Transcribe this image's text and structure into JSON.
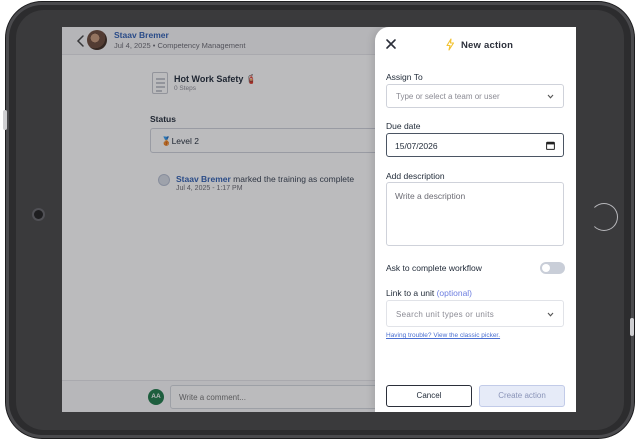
{
  "header": {
    "user_name": "Staav Bremer",
    "subtitle": "Jul 4, 2025 • Competency Management"
  },
  "training": {
    "title": "Hot Work Safety 🧯",
    "steps": "0 Steps"
  },
  "status": {
    "label": "Status",
    "value": "🥉Level 2"
  },
  "activity": {
    "actor": "Staav Bremer",
    "action": " marked the training as complete",
    "time": "Jul 4, 2025 - 1:17 PM"
  },
  "comment": {
    "avatar_initials": "AA",
    "placeholder": "Write a comment..."
  },
  "drawer": {
    "title": "New action",
    "assign_to": {
      "label": "Assign To",
      "placeholder": "Type or select a team or user"
    },
    "due_date": {
      "label": "Due date",
      "value": "15/07/2026"
    },
    "description": {
      "label": "Add description",
      "placeholder": "Write a description"
    },
    "workflow": {
      "label": "Ask to complete workflow",
      "enabled": false
    },
    "unit": {
      "label": "Link to a unit",
      "optional": "(optional)",
      "placeholder": "Search unit types or units"
    },
    "help_link": "Having trouble? View the classic picker.",
    "cancel_label": "Cancel",
    "create_label": "Create action"
  },
  "colors": {
    "link_blue": "#2f5fb3",
    "avatar_green": "#1f7a4a",
    "bolt_yellow": "#f2c230",
    "create_disabled_bg": "#e6ebf8"
  },
  "icons": [
    "back-icon",
    "close-icon",
    "bolt-icon",
    "chevron-down-icon",
    "calendar-icon",
    "document-icon"
  ]
}
